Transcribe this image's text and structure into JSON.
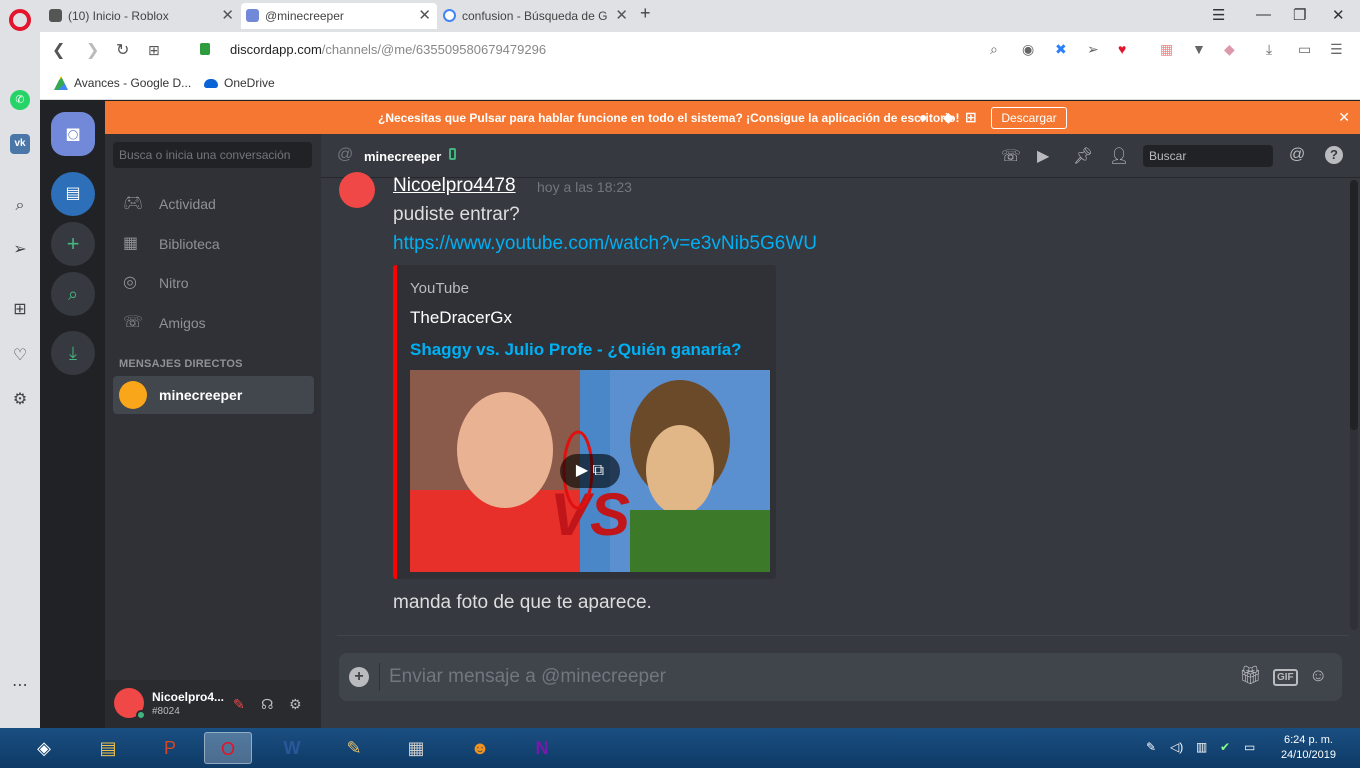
{
  "browser": {
    "tabs": [
      {
        "title": "(10) Inicio - Roblox"
      },
      {
        "title": "@minecreeper"
      },
      {
        "title": "confusion - Búsqueda de G"
      }
    ],
    "url_host": "discordapp.com",
    "url_path": "/channels/@me/635509580679479296",
    "bookmarks": [
      {
        "label": "Avances - Google D..."
      },
      {
        "label": "OneDrive"
      }
    ]
  },
  "banner": {
    "text": "¿Necesitas que Pulsar para hablar funcione en todo el sistema? ¡Consigue la aplicación de escritorio!",
    "button": "Descargar"
  },
  "dm_panel": {
    "search_placeholder": "Busca o inicia una conversación",
    "nav": [
      {
        "label": "Actividad"
      },
      {
        "label": "Biblioteca"
      },
      {
        "label": "Nitro"
      },
      {
        "label": "Amigos"
      }
    ],
    "section_header": "MENSAJES DIRECTOS",
    "dm_user": "minecreeper"
  },
  "user": {
    "name": "Nicoelpro4...",
    "tag": "#8024"
  },
  "channel": {
    "name": "minecreeper",
    "search_placeholder": "Buscar"
  },
  "message": {
    "author": "Nicoelpro4478",
    "timestamp": "hoy a las 18:23",
    "line1": "pudiste entrar?",
    "link": "https://www.youtube.com/watch?v=e3vNib5G6WU",
    "line3": "manda foto de que te aparece."
  },
  "embed": {
    "provider": "YouTube",
    "author": "TheDracerGx",
    "title": "Shaggy vs. Julio Profe - ¿Quién ganaría?"
  },
  "composer": {
    "placeholder": "Enviar mensaje a @minecreeper"
  },
  "taskbar": {
    "time": "6:24 p. m.",
    "date": "24/10/2019"
  },
  "colors": {
    "accent": "#7289da",
    "banner": "#f57731",
    "link": "#00b0f4",
    "online": "#43b581"
  }
}
